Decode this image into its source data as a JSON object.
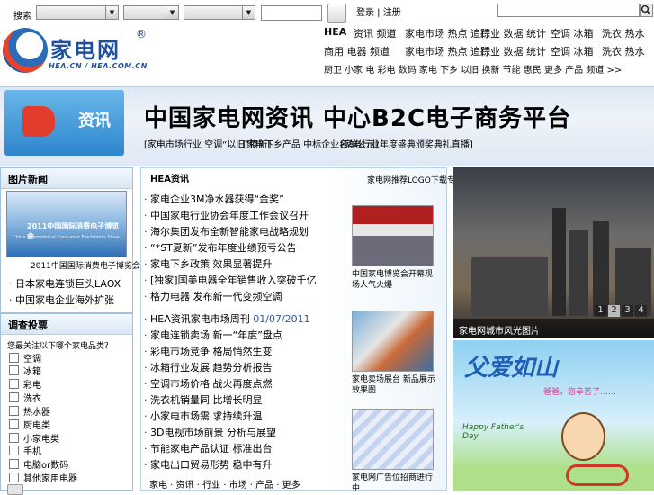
{
  "search": {
    "label": "搜索",
    "button_label": "",
    "login_links": "登录 | 注册"
  },
  "logo": {
    "name": "家电网",
    "registered": "®",
    "domains": "HEA.CN / HEA.COM.CN"
  },
  "nav": {
    "row1": [
      "HEA",
      "资讯 频道",
      "家电市场 热点 追踪",
      "行业 数据 统计",
      "空调 冰箱",
      "洗衣 热水"
    ],
    "row2": [
      "商用 电器 频道",
      "家电市场 热点 追踪",
      "行业 数据 统计",
      "空调 冰箱",
      "洗衣 热水"
    ],
    "row3": "厨卫 小家 电 彩电 数码 家电 下乡 以旧 换新 节能 惠民 更多 产品 频道 >>"
  },
  "banner": {
    "badge": "资讯",
    "title": "中国家电网资讯 中心B2C电子商务平台",
    "links": [
      "[家电市场行业 空调“以旧”换新]",
      "[家电下乡产品 中标企业名单公示]",
      "[家电行业年度盛典颁奖典礼直播]"
    ]
  },
  "left_panel": {
    "title": "图片新闻",
    "image_caption": "2011中国国际消费电子博览会",
    "expo_banner_text": "2011中国国际消费电子博览会",
    "expo_sub_text": "China International Consumer Electronics Show",
    "items": [
      "日本家电连锁巨头LAOX",
      "中国家电企业海外扩张"
    ]
  },
  "survey_panel": {
    "title": "调查投票",
    "question": "您最关注以下哪个家电品类？",
    "options": [
      "空调",
      "冰箱",
      "彩电",
      "洗衣",
      "热水器",
      "厨电类",
      "小家电类",
      "手机",
      "电脑or数码",
      "其他家用电器"
    ]
  },
  "news_panel": {
    "title": "HEA资讯",
    "header_link": "家电网推荐LOGO下载专区",
    "list1": [
      "家电企业3M净水器获得“金奖”",
      "中国家电行业协会年度工作会议召开",
      "海尔集团发布全新智能家电战略规划",
      "“*ST夏新”发布年度业绩预亏公告",
      "家电下乡政策 效果显著提升",
      "[独家]国美电器全年销售收入突破千亿",
      "格力电器 发布新一代变频空调"
    ],
    "list2_heading": "HEA资讯家电市场周刊",
    "list2_date": "01/07/2011",
    "list2": [
      "家电连锁卖场 新一“年度”盘点",
      "彩电市场竞争 格局悄然生变",
      "冰箱行业发展 趋势分析报告",
      "空调市场价格 战火再度点燃",
      "洗衣机销量同 比增长明显",
      "小家电市场需 求持续升温",
      "3D电视市场前景 分析与展望",
      "节能家电产品认证 标准出台",
      "家电出口贸易形势 稳中有升"
    ],
    "footer": [
      "家电 · 资讯 · 行业 · 市场 · 产品 · 更多"
    ]
  },
  "thumb_captions": [
    "中国家电博览会开幕现场人气火爆",
    "家电卖场展台 新品展示效果图",
    "家电网广告位招商进行中"
  ],
  "right_panel": {
    "slide_caption": "家电网城市风光图片",
    "pager": [
      "1",
      "2",
      "3",
      "4"
    ],
    "active_page": "2",
    "ad_title": "父爱如山",
    "ad_sub": "爸爸，您辛苦了……",
    "ad_card": "Happy Father's Day"
  },
  "colors": {
    "panel_border": "#9ec1de",
    "link_date": "#335599",
    "banner_bg": "#dfe8f4"
  }
}
